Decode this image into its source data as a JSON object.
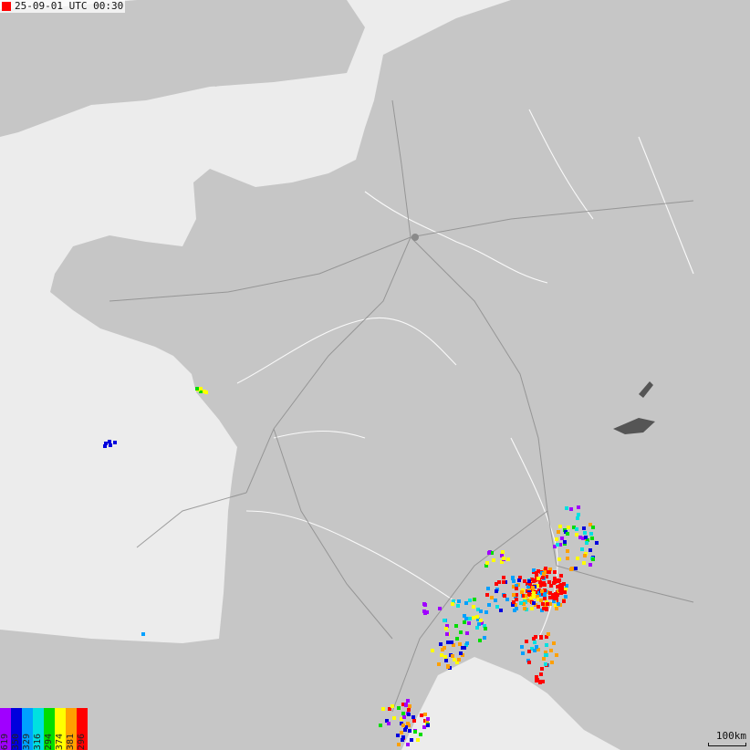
{
  "timestamp": "25-09-01 UTC 00:30",
  "scale_label": "100km",
  "colors": {
    "sea": "#ececec",
    "land": "#c6c6c6",
    "rivers": "#ffffff",
    "roads": "#8a8a8a",
    "marker": "#ff0000"
  },
  "legend": [
    {
      "label": "619",
      "color": "#a000ff"
    },
    {
      "label": "350",
      "color": "#0000dd"
    },
    {
      "label": "329",
      "color": "#00a0ff"
    },
    {
      "label": "316",
      "color": "#00e0e0"
    },
    {
      "label": "294",
      "color": "#00dd00"
    },
    {
      "label": "374",
      "color": "#ffff00"
    },
    {
      "label": "381",
      "color": "#ffa000"
    },
    {
      "label": "296",
      "color": "#ff0000"
    }
  ]
}
